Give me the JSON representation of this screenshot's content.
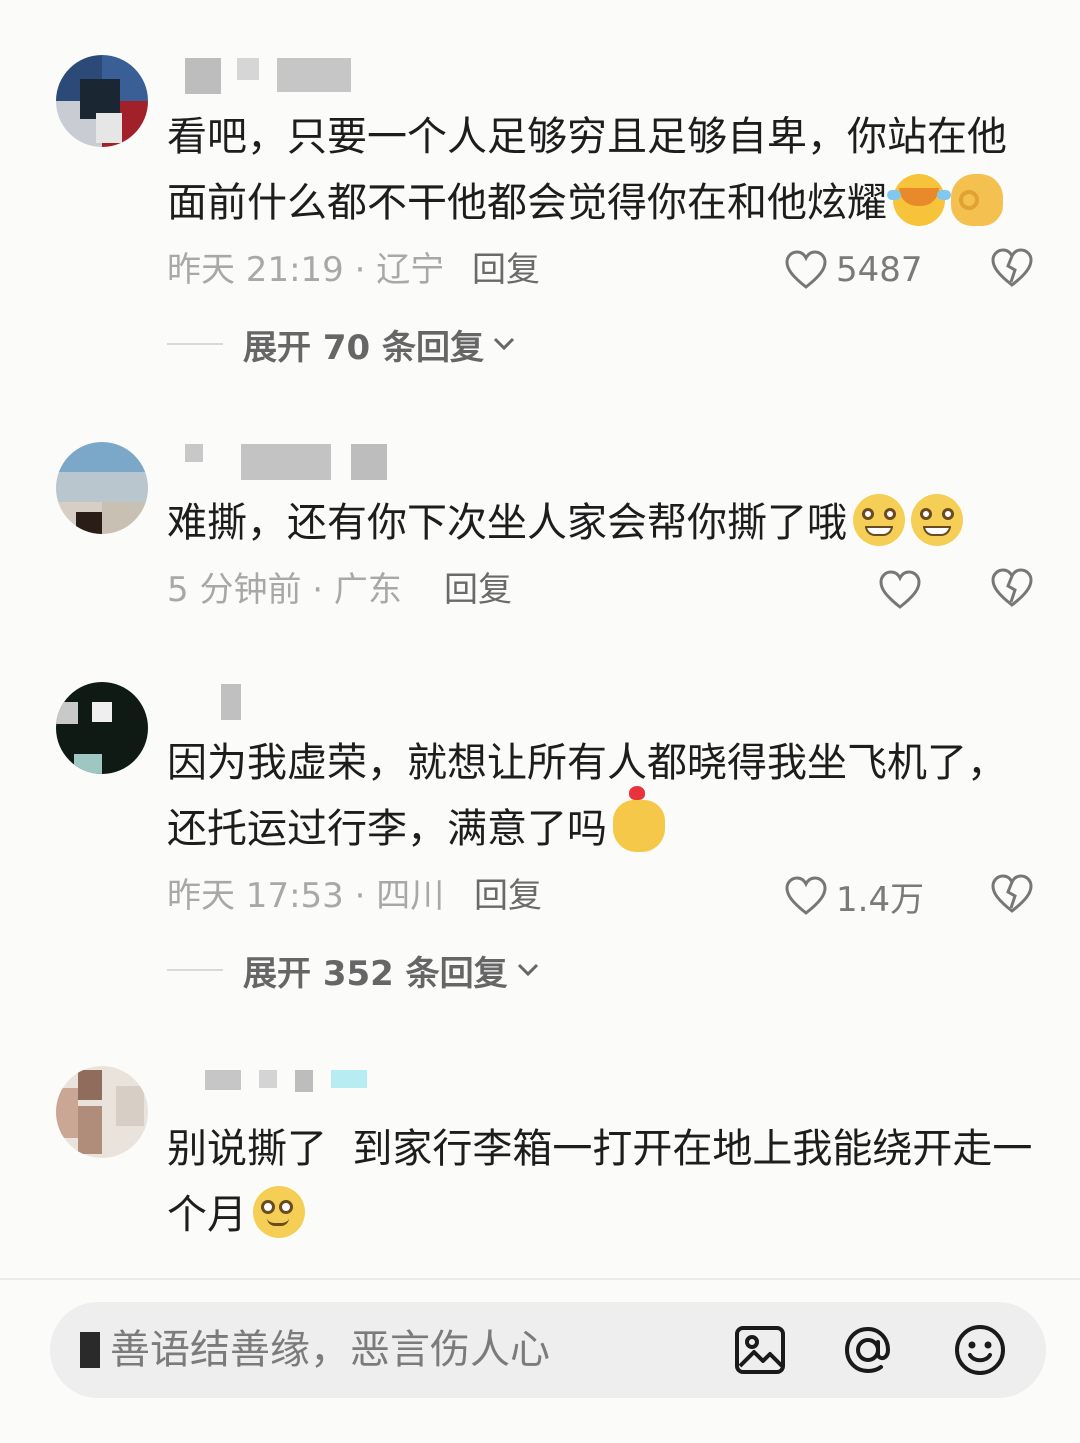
{
  "comments": [
    {
      "text": "看吧，只要一个人足够穷且足够自卑，你站在他面前什么都不干他都会觉得你在和他炫耀",
      "emojis": [
        "laughing-crying-emoji",
        "ok-hand-emoji"
      ],
      "meta": "昨天 21:19 · 辽宁",
      "reply_label": "回复",
      "likes": "5487",
      "expand": "展开 70 条回复"
    },
    {
      "text": "难撕，还有你下次坐人家会帮你撕了哦",
      "emojis": [
        "grinning-emoji",
        "grinning-emoji"
      ],
      "meta": "5 分钟前 · 广东",
      "reply_label": "回复",
      "likes": ""
    },
    {
      "text": "因为我虚荣，就想让所有人都晓得我坐飞机了，还托运过行李，满意了吗",
      "emojis": [
        "finger-heart-emoji"
      ],
      "meta": "昨天 17:53 · 四川",
      "reply_label": "回复",
      "likes": "1.4万",
      "expand": "展开 352 条回复"
    },
    {
      "text": "别说撕了  到家行李箱一打开在地上我能绕开走一个月",
      "emojis": [
        "dazzled-smile-emoji"
      ]
    }
  ],
  "input": {
    "placeholder": "善语结善缘，恶言伤人心"
  },
  "toolbar_icons": [
    "image-icon",
    "at-icon",
    "emoji-icon"
  ]
}
